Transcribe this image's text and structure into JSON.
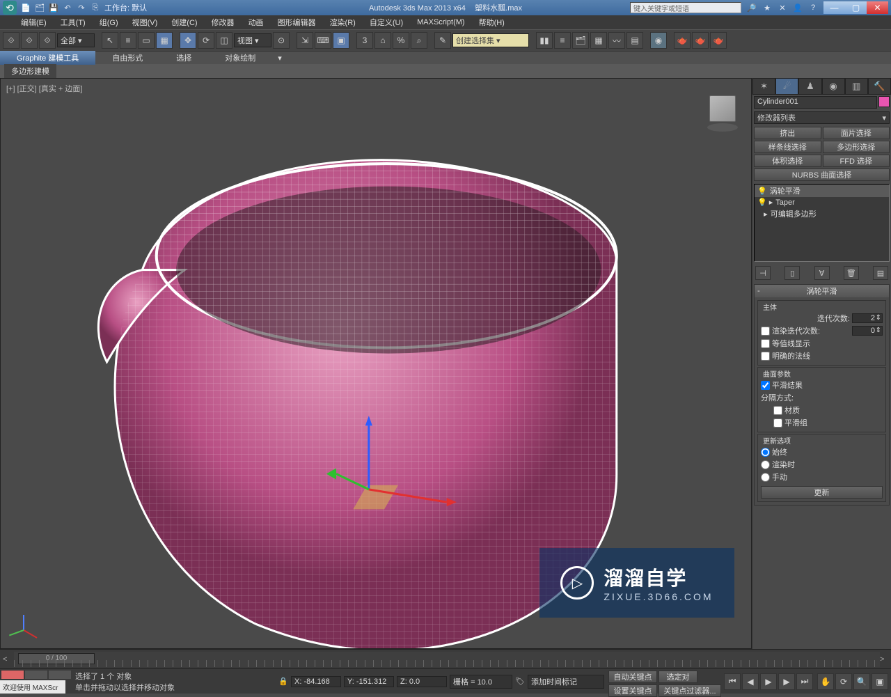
{
  "titlebar": {
    "workspaceLabel": "工作台: 默认",
    "appTitle": "Autodesk 3ds Max  2013 x64",
    "fileName": "塑料水瓢.max",
    "searchPlaceholder": "键入关键字或短语"
  },
  "menus": [
    "编辑(E)",
    "工具(T)",
    "组(G)",
    "视图(V)",
    "创建(C)",
    "修改器",
    "动画",
    "图形编辑器",
    "渲染(R)",
    "自定义(U)",
    "MAXScript(M)",
    "帮助(H)"
  ],
  "toolbar": {
    "selectionFilter": "全部",
    "coordSys": "视图"
  },
  "graphiteTabs": [
    "Graphite 建模工具",
    "自由形式",
    "选择",
    "对象绘制"
  ],
  "subGraphite": "多边形建模",
  "viewport": {
    "label": "[+] [正交] [真实 + 边面]"
  },
  "commandPanel": {
    "objectName": "Cylinder001",
    "modifierList": "修改器列表",
    "modButtons": [
      "挤出",
      "面片选择",
      "样条线选择",
      "多边形选择",
      "体积选择",
      "FFD 选择"
    ],
    "nurbsBtn": "NURBS 曲面选择",
    "stack": [
      "涡轮平滑",
      "Taper",
      "可编辑多边形"
    ],
    "rolloutTitle": "涡轮平滑",
    "mainGroup": "主体",
    "iterLabel": "迭代次数:",
    "iterVal": "2",
    "renderIterCheck": "渲染迭代次数:",
    "renderIterVal": "0",
    "isolineCheck": "等值线显示",
    "explicitNormals": "明确的法线",
    "surfParams": "曲面参数",
    "smoothResult": "平滑结果",
    "sepMethod": "分隔方式:",
    "matCheck": "材质",
    "smoothGrpCheck": "平滑组",
    "updateOpts": "更新选项",
    "always": "始终",
    "renderTime": "渲染时",
    "manual": "手动",
    "updateBtn": "更新"
  },
  "track": {
    "range": "0 / 100"
  },
  "status": {
    "welcome": "欢迎使用  MAXScr",
    "selected": "选择了 1 个 对象",
    "prompt": "单击并拖动以选择并移动对象",
    "coordX": "X: -84.168",
    "coordY": "Y: -151.312",
    "coordZ": "Z: 0.0",
    "grid": "栅格 = 10.0",
    "autoKey": "自动关键点",
    "selKey": "选定对",
    "addTimeTag": "添加时间标记",
    "setKey": "设置关键点",
    "keyFilter": "关键点过滤器..."
  },
  "watermark": {
    "big": "溜溜自学",
    "small": "ZIXUE.3D66.COM",
    "play": "▷"
  }
}
